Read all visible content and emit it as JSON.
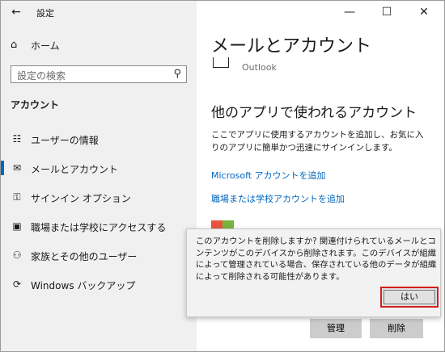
{
  "app": {
    "title": "設定"
  },
  "window_controls": {
    "minimize": "—",
    "maximize": "☐",
    "close": "✕"
  },
  "sidebar": {
    "home": "ホーム",
    "search_placeholder": "設定の検索",
    "section": "アカウント",
    "items": [
      {
        "label": "ユーザーの情報",
        "icon": "person-card-icon"
      },
      {
        "label": "メールとアカウント",
        "icon": "mail-icon",
        "active": true
      },
      {
        "label": "サインイン オプション",
        "icon": "key-icon"
      },
      {
        "label": "職場または学校にアクセスする",
        "icon": "briefcase-icon"
      },
      {
        "label": "家族とその他のユーザー",
        "icon": "person-add-icon"
      },
      {
        "label": "Windows バックアップ",
        "icon": "sync-icon"
      }
    ]
  },
  "main": {
    "title": "メールとアカウント",
    "outlook_label": "Outlook",
    "section_title": "他のアプリで使われるアカウント",
    "description": "ここでアプリに使用するアカウントを追加し、お気に入りのアプリに簡単かつ迅速にサインインします。",
    "link_microsoft": "Microsoft アカウントを追加",
    "link_work": "職場または学校アカウントを追加",
    "manage_button": "管理",
    "delete_button": "削除"
  },
  "dialog": {
    "message": "このアカウントを削除しますか? 関連付けられているメールとコンテンツがこのデバイスから削除されます。このデバイスが組織によって管理されている場合、保存されている他のデータが組織によって削除される可能性があります。",
    "yes_button": "はい"
  },
  "colors": {
    "accent": "#0067c0",
    "highlight": "#d61d1d"
  }
}
